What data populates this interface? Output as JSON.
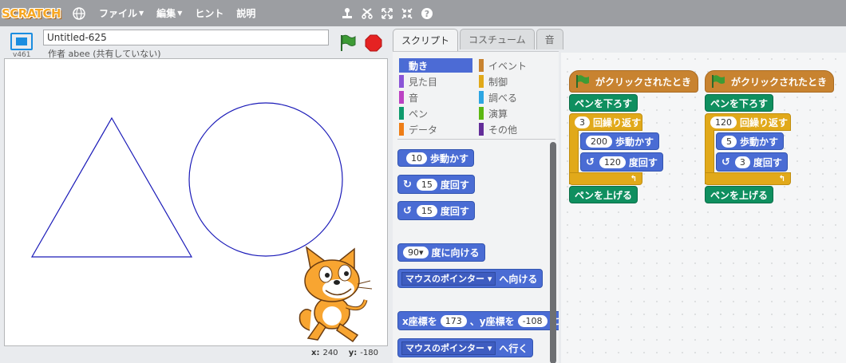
{
  "menubar": {
    "logo": "SCRATCH",
    "file": "ファイル",
    "edit": "編集",
    "hint": "ヒント",
    "about": "説明",
    "tools": [
      "stamp-icon",
      "cut-icon",
      "grow-icon",
      "shrink-icon",
      "help-icon"
    ]
  },
  "stage": {
    "project_title": "Untitled-625",
    "version": "v461",
    "author": "作者 abee (共有していない)",
    "x_label": "x:",
    "x_value": "240",
    "y_label": "y:",
    "y_value": "-180",
    "pen_color": "#1a1ab8"
  },
  "tabs": {
    "scripts": "スクリプト",
    "costumes": "コスチューム",
    "sounds": "音"
  },
  "categories": {
    "motion": "動き",
    "looks": "見た目",
    "sound": "音",
    "pen": "ペン",
    "data": "データ",
    "events": "イベント",
    "control": "制御",
    "sensing": "調べる",
    "operators": "演算",
    "more": "その他"
  },
  "palette_blocks": {
    "move_label": "歩動かす",
    "move_steps": "10",
    "turn_right_label": "度回す",
    "turn_right_deg": "15",
    "turn_left_label": "度回す",
    "turn_left_deg": "15",
    "point_dir_value": "90",
    "point_dir_label": "度に向ける",
    "point_towards_target": "マウスのポインター",
    "point_towards_label": "へ向ける",
    "goto_xy_x_label": "x座標を",
    "goto_xy_x": "173",
    "goto_xy_sep": "、y座標を",
    "goto_xy_y": "-108",
    "goto_xy_end": "に",
    "goto_target": "マウスのポインター",
    "goto_label": "へ行く"
  },
  "script1": {
    "hat": "がクリックされたとき",
    "pen_down": "ペンを下ろす",
    "repeat_count": "3",
    "repeat_label": "回繰り返す",
    "move_steps": "200",
    "move_label": "歩動かす",
    "turn_deg": "120",
    "turn_label": "度回す",
    "pen_up": "ペンを上げる"
  },
  "script2": {
    "hat": "がクリックされたとき",
    "pen_down": "ペンを下ろす",
    "repeat_count": "120",
    "repeat_label": "回繰り返す",
    "move_steps": "5",
    "move_label": "歩動かす",
    "turn_deg": "3",
    "turn_label": "度回す",
    "pen_up": "ペンを上げる"
  },
  "colors": {
    "motion": "#4a6cd4",
    "looks": "#8a55d7",
    "sound": "#bb42c3",
    "pen": "#0e9a6c",
    "data": "#ee7d16",
    "events": "#c88330",
    "control": "#e1a91a",
    "sensing": "#2ca5e2",
    "operators": "#5cb712",
    "more": "#632d99"
  }
}
